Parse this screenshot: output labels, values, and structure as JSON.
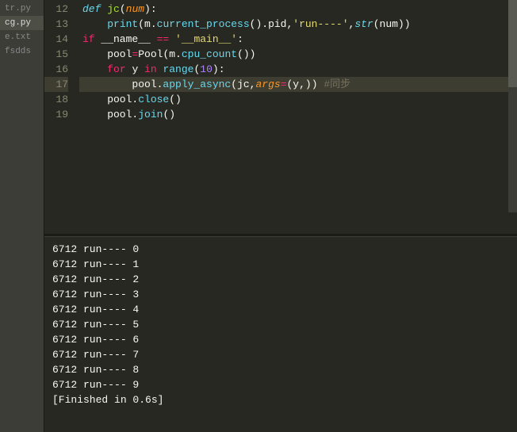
{
  "sidebar": {
    "tabs": [
      {
        "label": "tr.py",
        "active": false
      },
      {
        "label": "cg.py",
        "active": true
      },
      {
        "label": "e.txt",
        "active": false
      },
      {
        "label": "fsdds",
        "active": false
      }
    ]
  },
  "editor": {
    "first_line": 12,
    "highlight_line": 17,
    "lines": [
      [
        {
          "t": "def ",
          "c": "def"
        },
        {
          "t": "jc",
          "c": "fn"
        },
        {
          "t": "(",
          "c": "punct"
        },
        {
          "t": "num",
          "c": "param"
        },
        {
          "t": "):",
          "c": "punct"
        }
      ],
      [
        {
          "t": "    ",
          "c": "punct"
        },
        {
          "t": "print",
          "c": "call"
        },
        {
          "t": "(m.",
          "c": "punct"
        },
        {
          "t": "current_process",
          "c": "call"
        },
        {
          "t": "().pid,",
          "c": "punct"
        },
        {
          "t": "'run----'",
          "c": "str"
        },
        {
          "t": ",",
          "c": "punct"
        },
        {
          "t": "str",
          "c": "builtin"
        },
        {
          "t": "(num))",
          "c": "punct"
        }
      ],
      [
        {
          "t": "if ",
          "c": "kw2"
        },
        {
          "t": "__name__ ",
          "c": "punct"
        },
        {
          "t": "==",
          "c": "kw2"
        },
        {
          "t": " ",
          "c": "punct"
        },
        {
          "t": "'__main__'",
          "c": "str"
        },
        {
          "t": ":",
          "c": "punct"
        }
      ],
      [
        {
          "t": "    pool",
          "c": "punct"
        },
        {
          "t": "=",
          "c": "kw2"
        },
        {
          "t": "Pool(m.",
          "c": "punct"
        },
        {
          "t": "cpu_count",
          "c": "call"
        },
        {
          "t": "())",
          "c": "punct"
        }
      ],
      [
        {
          "t": "    ",
          "c": "punct"
        },
        {
          "t": "for ",
          "c": "kw2"
        },
        {
          "t": "y ",
          "c": "punct"
        },
        {
          "t": "in ",
          "c": "kw2"
        },
        {
          "t": "range",
          "c": "call"
        },
        {
          "t": "(",
          "c": "punct"
        },
        {
          "t": "10",
          "c": "num"
        },
        {
          "t": "):",
          "c": "punct"
        }
      ],
      [
        {
          "t": "        pool.",
          "c": "punct"
        },
        {
          "t": "apply_async",
          "c": "call"
        },
        {
          "t": "(jc,",
          "c": "punct"
        },
        {
          "t": "args",
          "c": "param"
        },
        {
          "t": "=",
          "c": "kw2"
        },
        {
          "t": "(y,)) ",
          "c": "punct"
        },
        {
          "t": "#同步",
          "c": "comment"
        }
      ],
      [
        {
          "t": "    pool.",
          "c": "punct"
        },
        {
          "t": "close",
          "c": "call"
        },
        {
          "t": "()",
          "c": "punct"
        }
      ],
      [
        {
          "t": "    pool.",
          "c": "punct"
        },
        {
          "t": "join",
          "c": "call"
        },
        {
          "t": "()",
          "c": "punct"
        }
      ]
    ]
  },
  "console": {
    "lines": [
      "6712 run---- 0",
      "6712 run---- 1",
      "6712 run---- 2",
      "6712 run---- 3",
      "6712 run---- 4",
      "6712 run---- 5",
      "6712 run---- 6",
      "6712 run---- 7",
      "6712 run---- 8",
      "6712 run---- 9",
      "[Finished in 0.6s]"
    ]
  }
}
